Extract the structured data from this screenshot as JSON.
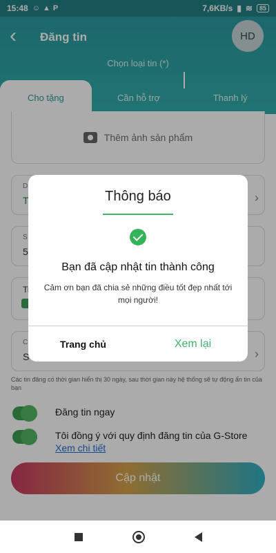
{
  "status_bar": {
    "time": "15:48",
    "network_speed": "7,6KB/s",
    "battery": "85"
  },
  "header": {
    "back_icon": "chevron-left-icon",
    "title": "Đăng tin",
    "avatar_initials": "HD",
    "subtitle": "Chọn loại tin (*)"
  },
  "tabs": [
    {
      "label": "Cho tặng",
      "active": true
    },
    {
      "label": "Cần hỗ trợ",
      "active": false
    },
    {
      "label": "Thanh lý",
      "active": false
    }
  ],
  "form": {
    "add_photo_label": "Thêm ảnh sản phẩm",
    "field1_label_partial": "D",
    "field1_value_partial": "T",
    "field2_label_partial": "S",
    "field2_value_partial": "5",
    "field3_label_partial": "Tin",
    "field4_label_partial": "C",
    "field4_value_partial": "S",
    "note": "Các tin đăng có thời gian hiển thị 30 ngày, sau thời gian này hệ thống sẽ tự động ẩn tin của bạn",
    "post_now_label": "Đăng tin ngay",
    "agree_label": "Tôi đồng ý với quy định đăng tin của G-Store",
    "details_link": "Xem chi tiết",
    "update_button": "Cập nhật"
  },
  "dialog": {
    "title": "Thông báo",
    "heading": "Bạn đã cập nhật tin thành công",
    "message": "Cảm ơn bạn đã chia sẻ những điều tốt đẹp nhất tới mọi người!",
    "home_button": "Trang chủ",
    "review_button": "Xem lại"
  },
  "colors": {
    "header": "#2b9aa0",
    "accent_green": "#3eb56a",
    "link": "#1f6fd0"
  }
}
